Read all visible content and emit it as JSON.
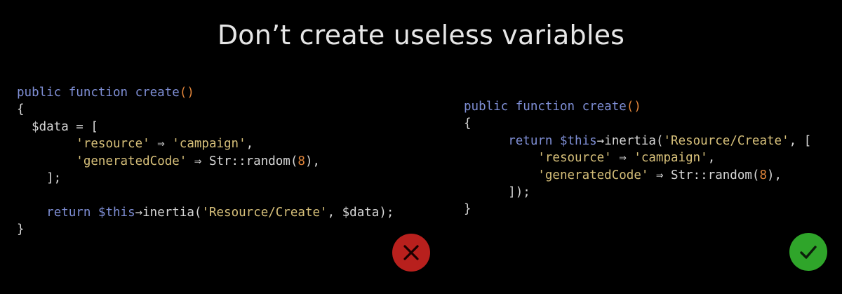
{
  "title": "Don’t create useless variables",
  "colors": {
    "background": "#000000",
    "keyword": "#7f8fd6",
    "string": "#d7c07a",
    "number": "#e0843a",
    "bad_badge": "#b8201d",
    "good_badge": "#2fa52a"
  },
  "bad_example": {
    "l1_kw": "public function ",
    "l1_fn": "create",
    "l1_paren": "()",
    "l2": "{",
    "l3_indent": "  ",
    "l3_var": "$data",
    "l3_rest": " = [",
    "l4_indent": "        ",
    "l4_key": "'resource'",
    "l4_arrow": " ⇒ ",
    "l4_val": "'campaign'",
    "l4_end": ",",
    "l5_indent": "        ",
    "l5_key": "'generatedCode'",
    "l5_arrow": " ⇒ ",
    "l5_call": "Str::random(",
    "l5_num": "8",
    "l5_end": "),",
    "l6": "    ];",
    "l7": "",
    "l8_indent": "    ",
    "l8_kw": "return ",
    "l8_var": "$this",
    "l8_call": "→inertia(",
    "l8_str": "'Resource/Create'",
    "l8_end": ", $data);",
    "l9": "}",
    "icon": "close-icon"
  },
  "good_example": {
    "l1_kw": "public function ",
    "l1_fn": "create",
    "l1_paren": "()",
    "l2": "{",
    "l3_indent": "      ",
    "l3_kw": "return ",
    "l3_var": "$this",
    "l3_call": "→inertia(",
    "l3_str": "'Resource/Create'",
    "l3_end": ", [",
    "l4_indent": "          ",
    "l4_key": "'resource'",
    "l4_arrow": " ⇒ ",
    "l4_val": "'campaign'",
    "l4_end": ",",
    "l5_indent": "          ",
    "l5_key": "'generatedCode'",
    "l5_arrow": " ⇒ ",
    "l5_call": "Str::random(",
    "l5_num": "8",
    "l5_end": "),",
    "l6": "      ]);",
    "l7": "}",
    "icon": "check-icon"
  }
}
